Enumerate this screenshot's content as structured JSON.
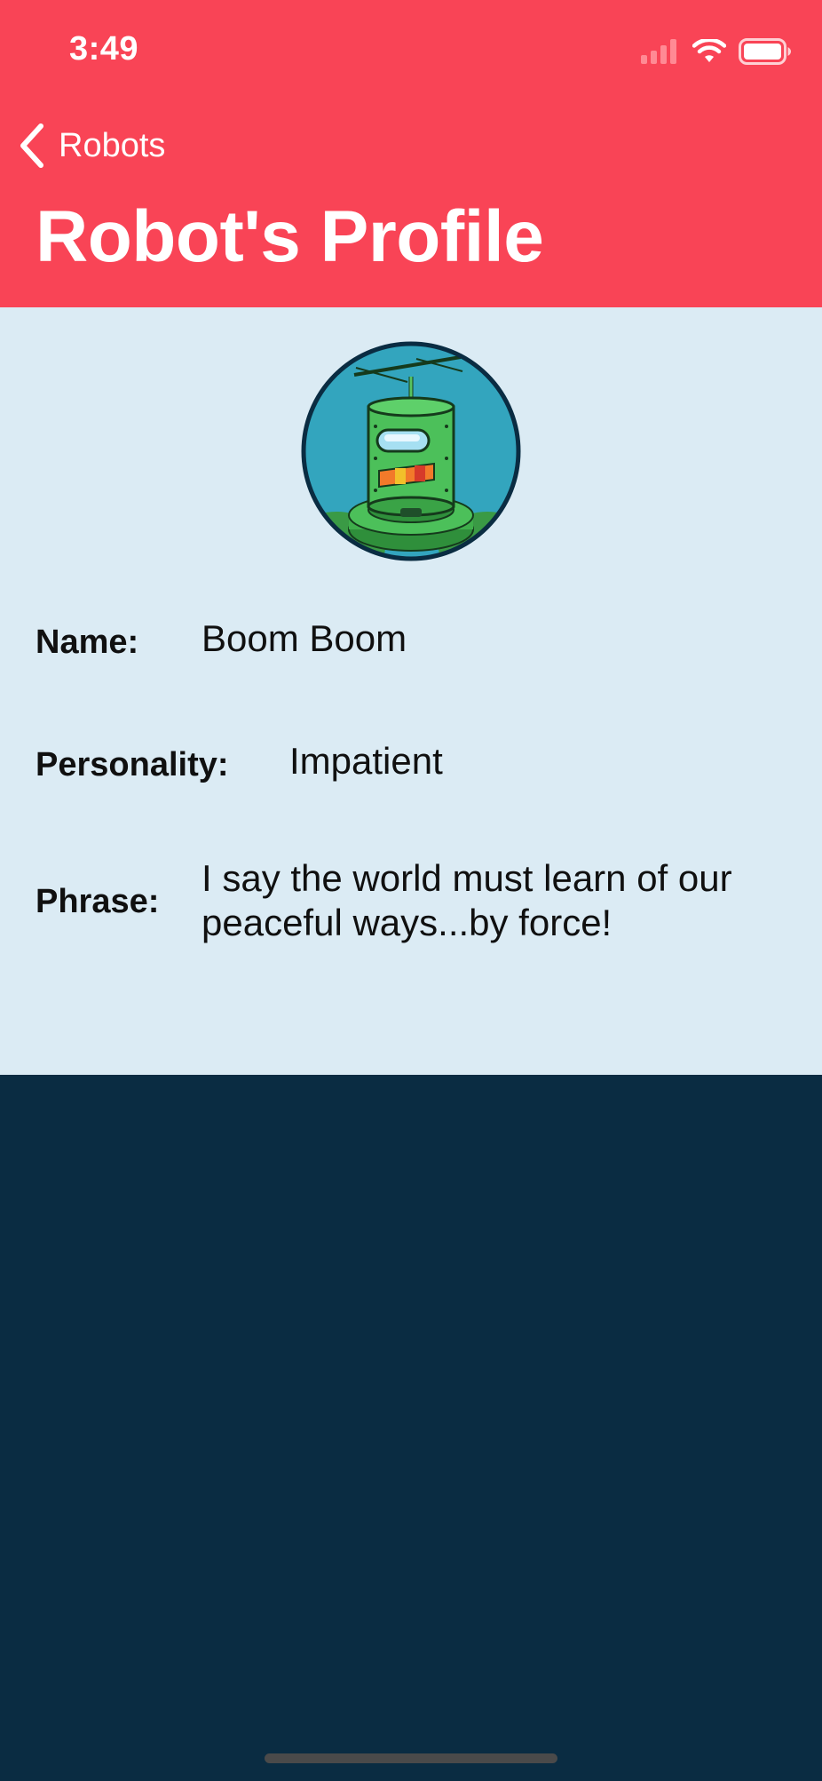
{
  "status_bar": {
    "time": "3:49"
  },
  "nav": {
    "back_label": "Robots",
    "title": "Robot's Profile"
  },
  "profile": {
    "avatar_icon": "robot-avatar",
    "name_label": "Name:",
    "name_value": "Boom Boom",
    "personality_label": "Personality:",
    "personality_value": "Impatient",
    "phrase_label": "Phrase:",
    "phrase_value": "I say the world must learn of our peaceful ways...by force!"
  },
  "colors": {
    "header": "#f94456",
    "content_bg": "#dbebf4",
    "bottom_bg": "#0a2c42"
  }
}
